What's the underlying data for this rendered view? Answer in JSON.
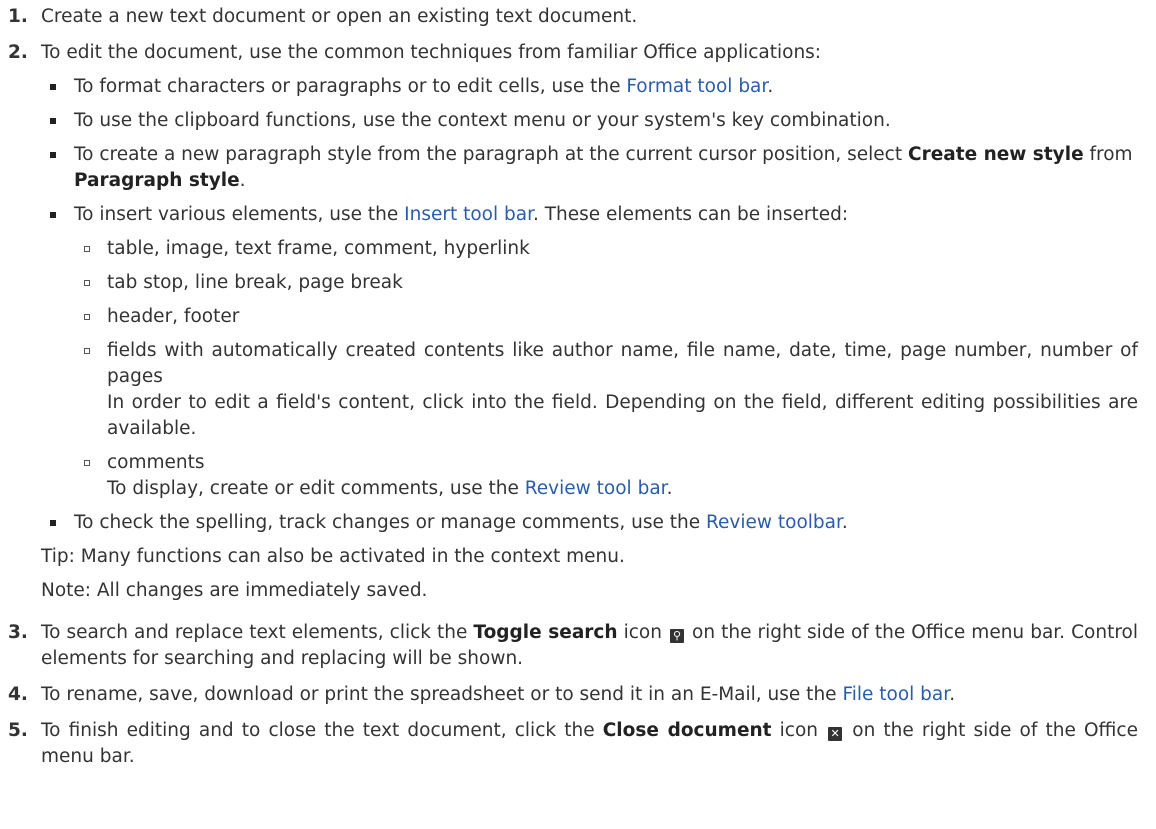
{
  "steps": [
    {
      "num": "1.",
      "text": "Create a new text document or open an existing text document."
    },
    {
      "num": "2.",
      "text": "To edit the document, use the common techniques from familiar Office applications:",
      "bullets": {
        "format": {
          "pre": "To format characters or paragraphs or to edit cells, use the ",
          "link": "Format tool bar",
          "post": "."
        },
        "clipboard": {
          "text": "To use the clipboard functions, use the context menu or your system's key combination."
        },
        "style": {
          "pre": "To create a new paragraph style from the paragraph at the current cursor position, select ",
          "b1": "Create new style",
          "mid": " from ",
          "b2": "Paragraph style",
          "post": "."
        },
        "insert": {
          "pre": "To insert various elements, use the ",
          "link": "Insert tool bar",
          "post": ". These elements can be inserted:",
          "items": {
            "i0": "table, image, text frame, comment, hyperlink",
            "i1": "tab stop, line break, page break",
            "i2": "header, footer",
            "i3": "fields with automatically created contents like author name, file name, date, time, page number, number of pages",
            "i3_note": "In order to edit a field's content, click into the field. Depending on the field, different editing possibilities are available.",
            "i4": "comments",
            "i4_pre": "To display, create or edit comments, use the ",
            "i4_link": "Review tool bar",
            "i4_post": "."
          }
        },
        "spelling": {
          "pre": "To check the spelling, track changes or manage comments, use the ",
          "link": "Review toolbar",
          "post": "."
        }
      },
      "tip": "Tip: Many functions can also be activated in the context menu.",
      "note": "Note: All changes are immediately saved."
    },
    {
      "num": "3.",
      "pre": "To search and replace text elements, click the ",
      "bold": "Toggle search",
      "mid": " icon ",
      "post": " on the right side of the Office menu bar. Control elements for searching and replacing will be shown."
    },
    {
      "num": "4.",
      "pre": "To rename, save, download or print the spreadsheet or to send it in an E-Mail, use the ",
      "link": "File tool bar",
      "post": "."
    },
    {
      "num": "5.",
      "pre": "To finish editing and to close the text document, click the ",
      "bold": "Close document",
      "mid": " icon ",
      "post": " on the right side of the Office menu bar."
    }
  ],
  "icons": {
    "search": "search-icon",
    "close": "close-icon"
  }
}
